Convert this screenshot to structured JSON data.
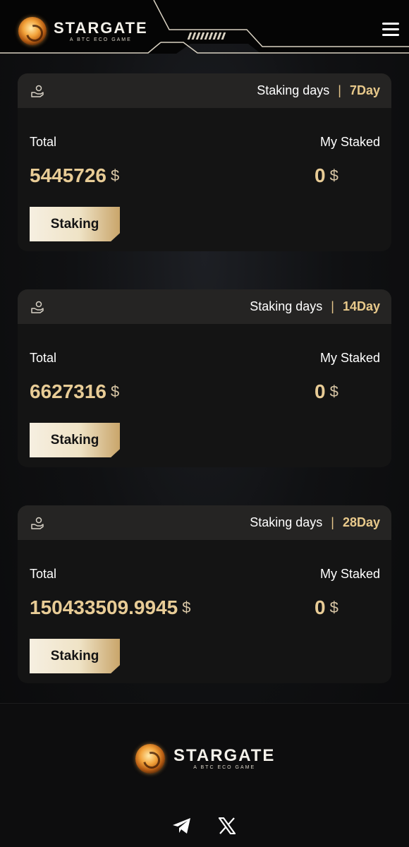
{
  "brand": {
    "name": "STARGATE",
    "tagline": "A BTC ECO GAME"
  },
  "header": {
    "menu_icon": "hamburger-menu-icon"
  },
  "colors": {
    "accent_gold": "#e8c98b",
    "card_bg": "#141414",
    "card_header_bg": "#252423"
  },
  "pools": [
    {
      "days_label": "Staking days",
      "days_value": "7Day",
      "total_label": "Total",
      "total_value": "5445726",
      "my_staked_label": "My Staked",
      "my_staked_value": "0",
      "currency_symbol": "$",
      "button_label": "Staking"
    },
    {
      "days_label": "Staking days",
      "days_value": "14Day",
      "total_label": "Total",
      "total_value": "6627316",
      "my_staked_label": "My Staked",
      "my_staked_value": "0",
      "currency_symbol": "$",
      "button_label": "Staking"
    },
    {
      "days_label": "Staking days",
      "days_value": "28Day",
      "total_label": "Total",
      "total_value": "150433509.9945",
      "my_staked_label": "My Staked",
      "my_staked_value": "0",
      "currency_symbol": "$",
      "button_label": "Staking"
    }
  ],
  "footer": {
    "socials": [
      "telegram-icon",
      "x-icon"
    ]
  }
}
